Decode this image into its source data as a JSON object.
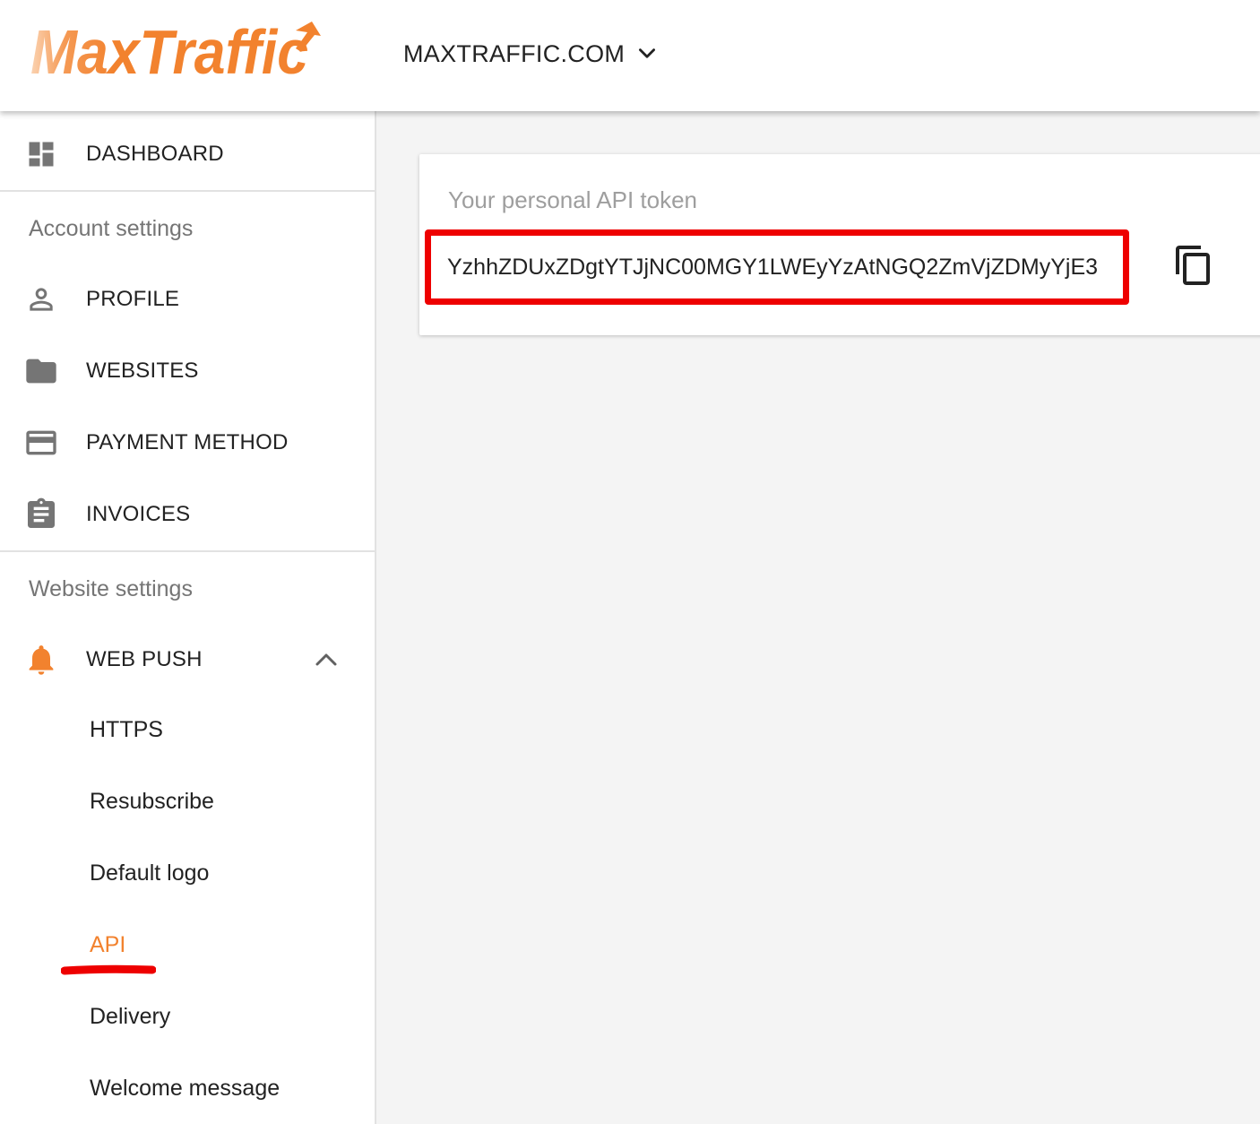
{
  "header": {
    "logo_text": "MaxTraffic",
    "site_selector_label": "MAXTRAFFIC.COM"
  },
  "sidebar": {
    "dashboard_label": "DASHBOARD",
    "account_section_title": "Account settings",
    "account_items": [
      {
        "label": "PROFILE",
        "icon": "person-icon"
      },
      {
        "label": "WEBSITES",
        "icon": "folder-icon"
      },
      {
        "label": "PAYMENT METHOD",
        "icon": "credit-card-icon"
      },
      {
        "label": "INVOICES",
        "icon": "clipboard-icon"
      }
    ],
    "website_section_title": "Website settings",
    "web_push_label": "WEB PUSH",
    "web_push_subitems": [
      {
        "label": "HTTPS"
      },
      {
        "label": "Resubscribe"
      },
      {
        "label": "Default logo"
      },
      {
        "label": "API",
        "active": true
      },
      {
        "label": "Delivery"
      },
      {
        "label": "Welcome message"
      }
    ]
  },
  "main": {
    "token_label": "Your personal API token",
    "token_value": "YzhhZDUxZDgtYTJjNC00MGY1LWEyYzAtNGQ2ZmVjZDMyYjE3"
  },
  "colors": {
    "brand_orange": "#f2822e",
    "highlight_red": "#ee0000",
    "icon_gray": "#757575"
  }
}
